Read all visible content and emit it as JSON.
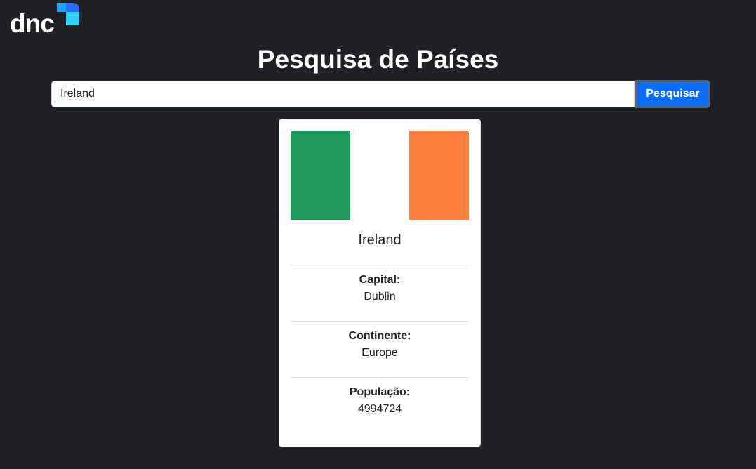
{
  "logo": {
    "text": "dnc",
    "colors": {
      "primary": "#2b6df6",
      "secondary": "#1fa2f7",
      "accent": "#2bd2f1"
    }
  },
  "page": {
    "title": "Pesquisa de Países"
  },
  "search": {
    "value": "Ireland",
    "placeholder": "",
    "button_label": "Pesquisar"
  },
  "result": {
    "country_name": "Ireland",
    "flag": {
      "stripes": [
        "#1e9a5a",
        "#ffffff",
        "#ff7f3e"
      ]
    },
    "fields": [
      {
        "label": "Capital:",
        "value": "Dublin"
      },
      {
        "label": "Continente:",
        "value": "Europe"
      },
      {
        "label": "População:",
        "value": "4994724"
      }
    ]
  }
}
